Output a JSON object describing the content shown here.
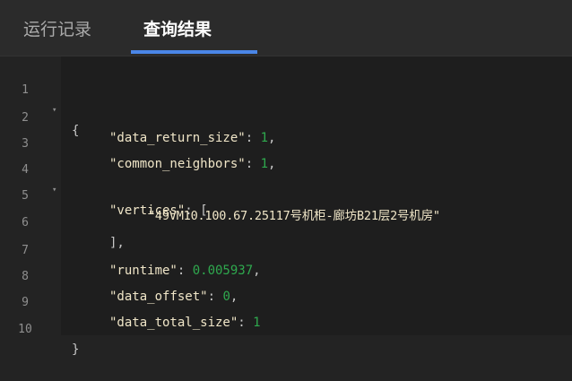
{
  "tabs": [
    {
      "label": "运行记录",
      "active": false
    },
    {
      "label": "查询结果",
      "active": true
    }
  ],
  "colors": {
    "accent": "#4a86e8",
    "number": "#2fa94e",
    "string": "#f0e6c8"
  },
  "code": {
    "lines": [
      {
        "num": "1",
        "fold": "▾",
        "text": "{"
      },
      {
        "num": "2",
        "fold": "",
        "key": "\"data_return_size\"",
        "sep": ": ",
        "value": "1",
        "tail": ","
      },
      {
        "num": "3",
        "fold": "",
        "key": "\"common_neighbors\"",
        "sep": ": ",
        "value": "1",
        "tail": ","
      },
      {
        "num": "4",
        "fold": "▾",
        "key": "\"vertices\"",
        "sep": ": ",
        "value": "",
        "tail": "["
      },
      {
        "num": "5",
        "fold": "",
        "str": "\"49VM10.100.67.25117号机柜-廊坊B21层2号机房\""
      },
      {
        "num": "6",
        "fold": "",
        "text": "],"
      },
      {
        "num": "7",
        "fold": "",
        "key": "\"runtime\"",
        "sep": ": ",
        "value": "0.005937",
        "tail": ","
      },
      {
        "num": "8",
        "fold": "",
        "key": "\"data_offset\"",
        "sep": ": ",
        "value": "0",
        "tail": ","
      },
      {
        "num": "9",
        "fold": "",
        "key": "\"data_total_size\"",
        "sep": ": ",
        "value": "1",
        "tail": ""
      },
      {
        "num": "10",
        "fold": "",
        "text": "}"
      }
    ]
  }
}
